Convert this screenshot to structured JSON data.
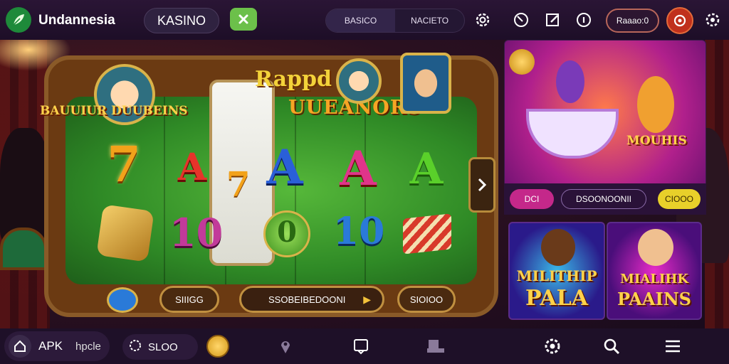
{
  "header": {
    "brand": "Undannesia",
    "search_text": "KASINO",
    "tabs": [
      "BASICO",
      "NACIETO"
    ],
    "account_label": "Raaao:0"
  },
  "game": {
    "title_line1": "Rappd",
    "title_line2": "UUEANORS",
    "reels": [
      [
        "7",
        "A",
        "0"
      ],
      [
        "A",
        "0"
      ],
      [
        "A",
        "10"
      ],
      [
        "A",
        "10"
      ]
    ],
    "left_button": "SIIIGG",
    "spin_label": "SSOBEIBEDOONI",
    "right_button": "SIOIOO"
  },
  "promo_main": {
    "title_left": "BAUUIUR DUUBEINS",
    "title_right": "MOUHIS",
    "chip_left": "DCI",
    "chip_center": "DSOONOONII",
    "chip_right": "CIOOO"
  },
  "promo_cards": [
    {
      "line1": "MILITHIP",
      "line2": "PALA"
    },
    {
      "line1": "MIALIHK",
      "line2": "PAAINS"
    }
  ],
  "bottom_nav": {
    "home_label": "APK",
    "home_sub": "hpcle",
    "slot_label": "SLOO"
  },
  "icons": [
    "leaf-icon",
    "close-icon",
    "gear-icon",
    "slash-icon",
    "edit-icon",
    "info-icon",
    "avatar-icon",
    "settings-icon",
    "home-icon",
    "gift-icon",
    "coin-icon",
    "location-pin-icon",
    "chat-icon",
    "cashier-icon",
    "search-icon",
    "menu-icon"
  ],
  "colors": {
    "accent_green": "#6cc04a",
    "felt_green": "#2f8a26",
    "gold": "#f3d23a"
  }
}
